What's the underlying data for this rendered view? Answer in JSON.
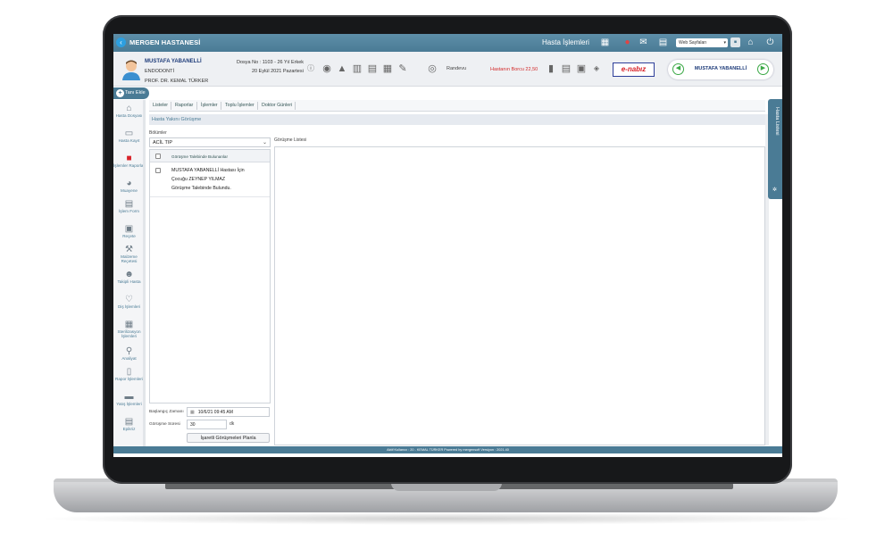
{
  "app": {
    "hospital": "MERGEN HASTANESİ",
    "menu": "Hasta İşlemleri",
    "web_select": "Web Sayfaları"
  },
  "patient": {
    "name": "MUSTAFA YABANELLİ",
    "department": "ENDODONTİ",
    "doctor": "PROF. DR. KEMAL TÜRKER",
    "file_info": "Dosya No : 1103 - 26 Yıl Erkek",
    "date": "20 Eylül 2021 Pazartesi",
    "appointment": "Randevu",
    "debt": "Hastanın Borcu 22,50",
    "nabiz": "e-nabız",
    "nav_name": "MUSTAFA YABANELLİ"
  },
  "tani_ekle": "Tanı Ekle",
  "sidebar": [
    {
      "label": "Hasta Dosyası",
      "icon": "home-icon"
    },
    {
      "label": "Hasta Kayıt",
      "icon": "id-card-icon"
    },
    {
      "label": "İşlemler Raporlar",
      "icon": "cube-icon"
    },
    {
      "label": "Muayene",
      "icon": "stethoscope-icon"
    },
    {
      "label": "İşlem Form",
      "icon": "form-icon"
    },
    {
      "label": "Reçete",
      "icon": "prescription-icon"
    },
    {
      "label": "Malzeme Reçetesi",
      "icon": "tools-icon"
    },
    {
      "label": "Takipli Hasta",
      "icon": "user-track-icon"
    },
    {
      "label": "Diş İşlemleri",
      "icon": "tooth-icon"
    },
    {
      "label": "Sterilizasyon İşlemleri",
      "icon": "sterilization-icon"
    },
    {
      "label": "Analiyat",
      "icon": "analysis-icon"
    },
    {
      "label": "Rapor İşlemleri",
      "icon": "report-icon"
    },
    {
      "label": "Yatış İşlemleri",
      "icon": "bed-icon"
    },
    {
      "label": "Epikriz",
      "icon": "epicrisis-icon"
    }
  ],
  "tabs": [
    "Listeler",
    "Raporlar",
    "İşlemler",
    "Toplu İşlemler",
    "Doktor Günleri"
  ],
  "page": {
    "title": "Hasta Yakını Görüşme",
    "bolumler_label": "Bölümler",
    "bolum_value": "ACİL TIP",
    "gorusme_list_label": "Görüşme Listesi",
    "list_header": "Görüşme Talebinde Bulunanlar",
    "list_item_lines": [
      "MUSTAFA YABANELLİ Hastası İçin",
      "Çocuğu ZEYNEP YILMAZ",
      "Görüşme Talebinde Bulundu."
    ]
  },
  "form": {
    "start_label": "Başlangıç Zamanı",
    "start_value": "10/6/21 09:45 AM",
    "duration_label": "Görüşme Süresi",
    "duration_value": "30",
    "duration_unit": "dk",
    "plan_button": "İşaretli Görüşmeleri Planla"
  },
  "hasta_listesi": "Hasta Listesi",
  "footer": "Aktif Kullanıcı : 20 - KEMAL TÜRKER    Powered by  mergensoft    Versiyon : 2021.40"
}
